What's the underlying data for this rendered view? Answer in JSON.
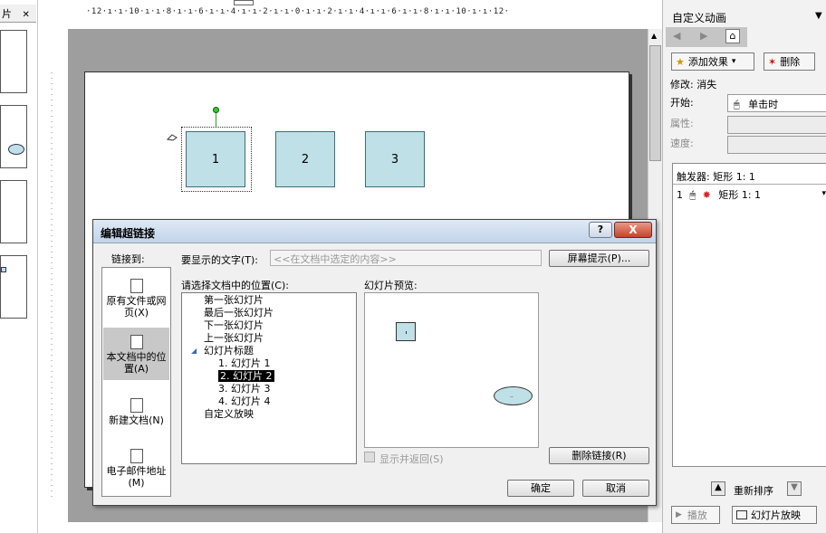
{
  "left_panel": {
    "tab_label": "片",
    "close_label": "✕"
  },
  "ruler": {
    "top_text": "·12·ı·ı·10·ı·ı·8·ı·ı·6·ı·ı·4·ı·ı·2·ı·ı·0·ı·ı·2·ı·ı·4·ı·ı·6·ı·ı·8·ı·ı·10·ı·ı·12·"
  },
  "slide": {
    "shapes": [
      "1",
      "2",
      "3"
    ]
  },
  "taskpane": {
    "title": "自定义动画",
    "add_effect_label": "添加效果",
    "delete_label": "删除",
    "modify_label": "修改: 消失",
    "start_label": "开始:",
    "start_value": "单击时",
    "property_label": "属性:",
    "speed_label": "速度:",
    "trigger_label": "触发器: 矩形 1: 1",
    "item_index": "1",
    "item_label": "矩形 1: 1",
    "reorder_label": "重新排序",
    "play_label": "播放",
    "slideshow_label": "幻灯片放映"
  },
  "dialog": {
    "title": "编辑超链接",
    "help_label": "?",
    "close_label": "X",
    "link_to_label": "链接到:",
    "link_options": [
      {
        "label_line1": "原有文件或网",
        "label_line2": "页(X)"
      },
      {
        "label_line1": "本文档中的位",
        "label_line2": "置(A)"
      },
      {
        "label_line1": "新建文档(N)",
        "label_line2": ""
      },
      {
        "label_line1": "电子邮件地址",
        "label_line2": "(M)"
      }
    ],
    "display_text_label": "要显示的文字(T):",
    "display_text_value": "<<在文档中选定的内容>>",
    "screentip_label": "屏幕提示(P)...",
    "place_label": "请选择文档中的位置(C):",
    "tree_items": [
      "第一张幻灯片",
      "最后一张幻灯片",
      "下一张幻灯片",
      "上一张幻灯片",
      "幻灯片标题",
      "1. 幻灯片 1",
      "2. 幻灯片 2",
      "3. 幻灯片 3",
      "4. 幻灯片 4",
      "自定义放映"
    ],
    "preview_label": "幻灯片预览:",
    "show_return_label": "显示并返回(S)",
    "remove_link_label": "删除链接(R)",
    "ok_label": "确定",
    "cancel_label": "取消"
  }
}
